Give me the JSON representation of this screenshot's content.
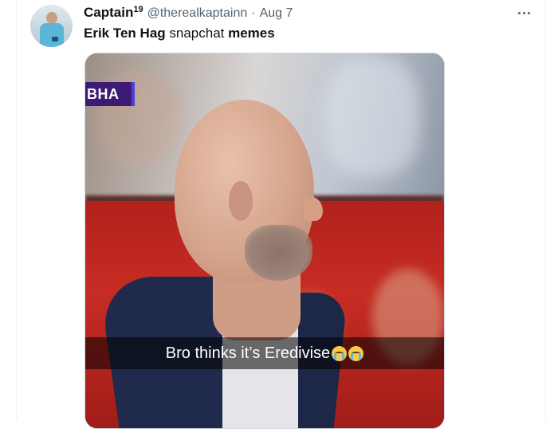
{
  "tweet": {
    "display_name": "Captain",
    "display_name_sup": "19",
    "handle": "@therealkaptainn",
    "separator": "·",
    "date": "Aug 7",
    "text_part1": "Erik Ten Hag",
    "text_part2": " snapchat ",
    "text_part3": "memes",
    "more_icon": "more-horizontal-icon"
  },
  "media": {
    "score_tag": "BHA",
    "caption": "Bro thinks it’s Eredivise",
    "caption_emoji": "loudly-crying-face",
    "caption_emoji_count": 2
  },
  "colors": {
    "secondary_text": "#536471",
    "divider": "#eff3f4",
    "score_tag_bg": "#3d1a74",
    "score_tag_accent": "#4f3fd9"
  }
}
